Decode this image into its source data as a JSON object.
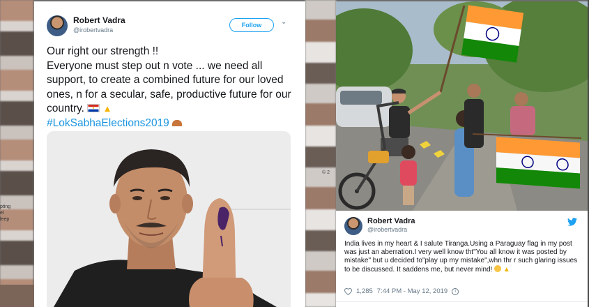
{
  "left_tweet": {
    "name": "Robert Vadra",
    "handle": "@irobertvadra",
    "follow_label": "Follow",
    "line1": "Our right our strength !!",
    "line2": "Everyone must step out n vote ... we need all support, to create a combined future for our loved ones, n for a secular, safe, productive future for our country.",
    "hashtag": "#LokSabhaElections2019"
  },
  "right_tweet": {
    "name": "Robert Vadra",
    "handle": "@irobertvadra",
    "text": "India lives in my heart & I salute Tiranga.Using a Paraguay flag in my post was just an aberration.I very well know tht\"You all know it was posted by mistake\" but u decided to\"play up my mistake\",whn thr r such glaring issues to be discussed. It saddens me, but never mind!",
    "likes": "1,285",
    "timestamp": "7:44 PM - May 12, 2019"
  },
  "background": {
    "left_snippet": "pting\nel\nleep",
    "mid_snippet": "© 2"
  },
  "colors": {
    "twitter_blue": "#1da1f2",
    "india_saffron": "#ff9933",
    "india_green": "#138808",
    "paraguay_red": "#d52b1e",
    "paraguay_blue": "#0038a8"
  }
}
